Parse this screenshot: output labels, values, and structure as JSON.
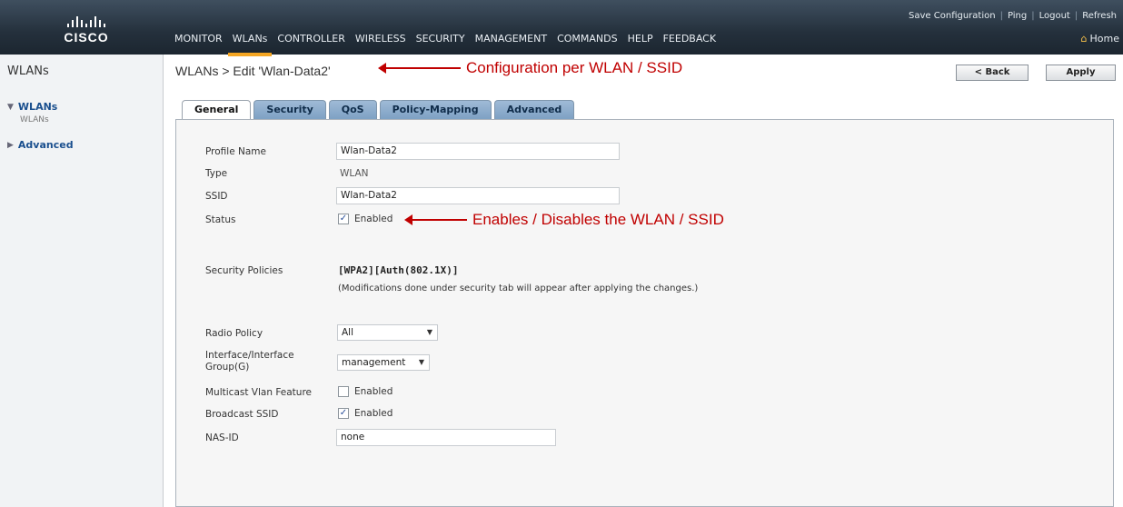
{
  "header": {
    "logo_text": "CISCO",
    "util_links": [
      "Save Configuration",
      "Ping",
      "Logout",
      "Refresh"
    ],
    "nav": [
      "MONITOR",
      "WLANs",
      "CONTROLLER",
      "WIRELESS",
      "SECURITY",
      "MANAGEMENT",
      "COMMANDS",
      "HELP",
      "FEEDBACK"
    ],
    "active_nav": "WLANs",
    "home_label": "Home",
    "accent_color": "#f5a623"
  },
  "sidebar": {
    "title": "WLANs",
    "items": [
      {
        "label": "WLANs",
        "expanded": true,
        "sub": "WLANs"
      },
      {
        "label": "Advanced",
        "expanded": false
      }
    ]
  },
  "main": {
    "page_title": "WLANs > Edit  'Wlan-Data2'",
    "back_label": "< Back",
    "apply_label": "Apply",
    "tabs": [
      "General",
      "Security",
      "QoS",
      "Policy-Mapping",
      "Advanced"
    ],
    "active_tab": "General"
  },
  "annotations": {
    "top": "Configuration  per WLAN / SSID",
    "status": "Enables / Disables the WLAN / SSID",
    "color": "#c00000"
  },
  "form": {
    "profile_name_label": "Profile Name",
    "profile_name_value": "Wlan-Data2",
    "type_label": "Type",
    "type_value": "WLAN",
    "ssid_label": "SSID",
    "ssid_value": "Wlan-Data2",
    "status_label": "Status",
    "status_enabled_label": "Enabled",
    "status_checked": true,
    "security_policies_label": "Security Policies",
    "security_policies_value": "[WPA2][Auth(802.1X)]",
    "security_note": "(Modifications done under security tab will appear after applying the changes.)",
    "radio_policy_label": "Radio Policy",
    "radio_policy_value": "All",
    "interface_label": "Interface/Interface Group(G)",
    "interface_value": "management",
    "multicast_label": "Multicast Vlan Feature",
    "multicast_enabled_label": "Enabled",
    "multicast_checked": false,
    "broadcast_label": "Broadcast SSID",
    "broadcast_enabled_label": "Enabled",
    "broadcast_checked": true,
    "nas_id_label": "NAS-ID",
    "nas_id_value": "none"
  }
}
